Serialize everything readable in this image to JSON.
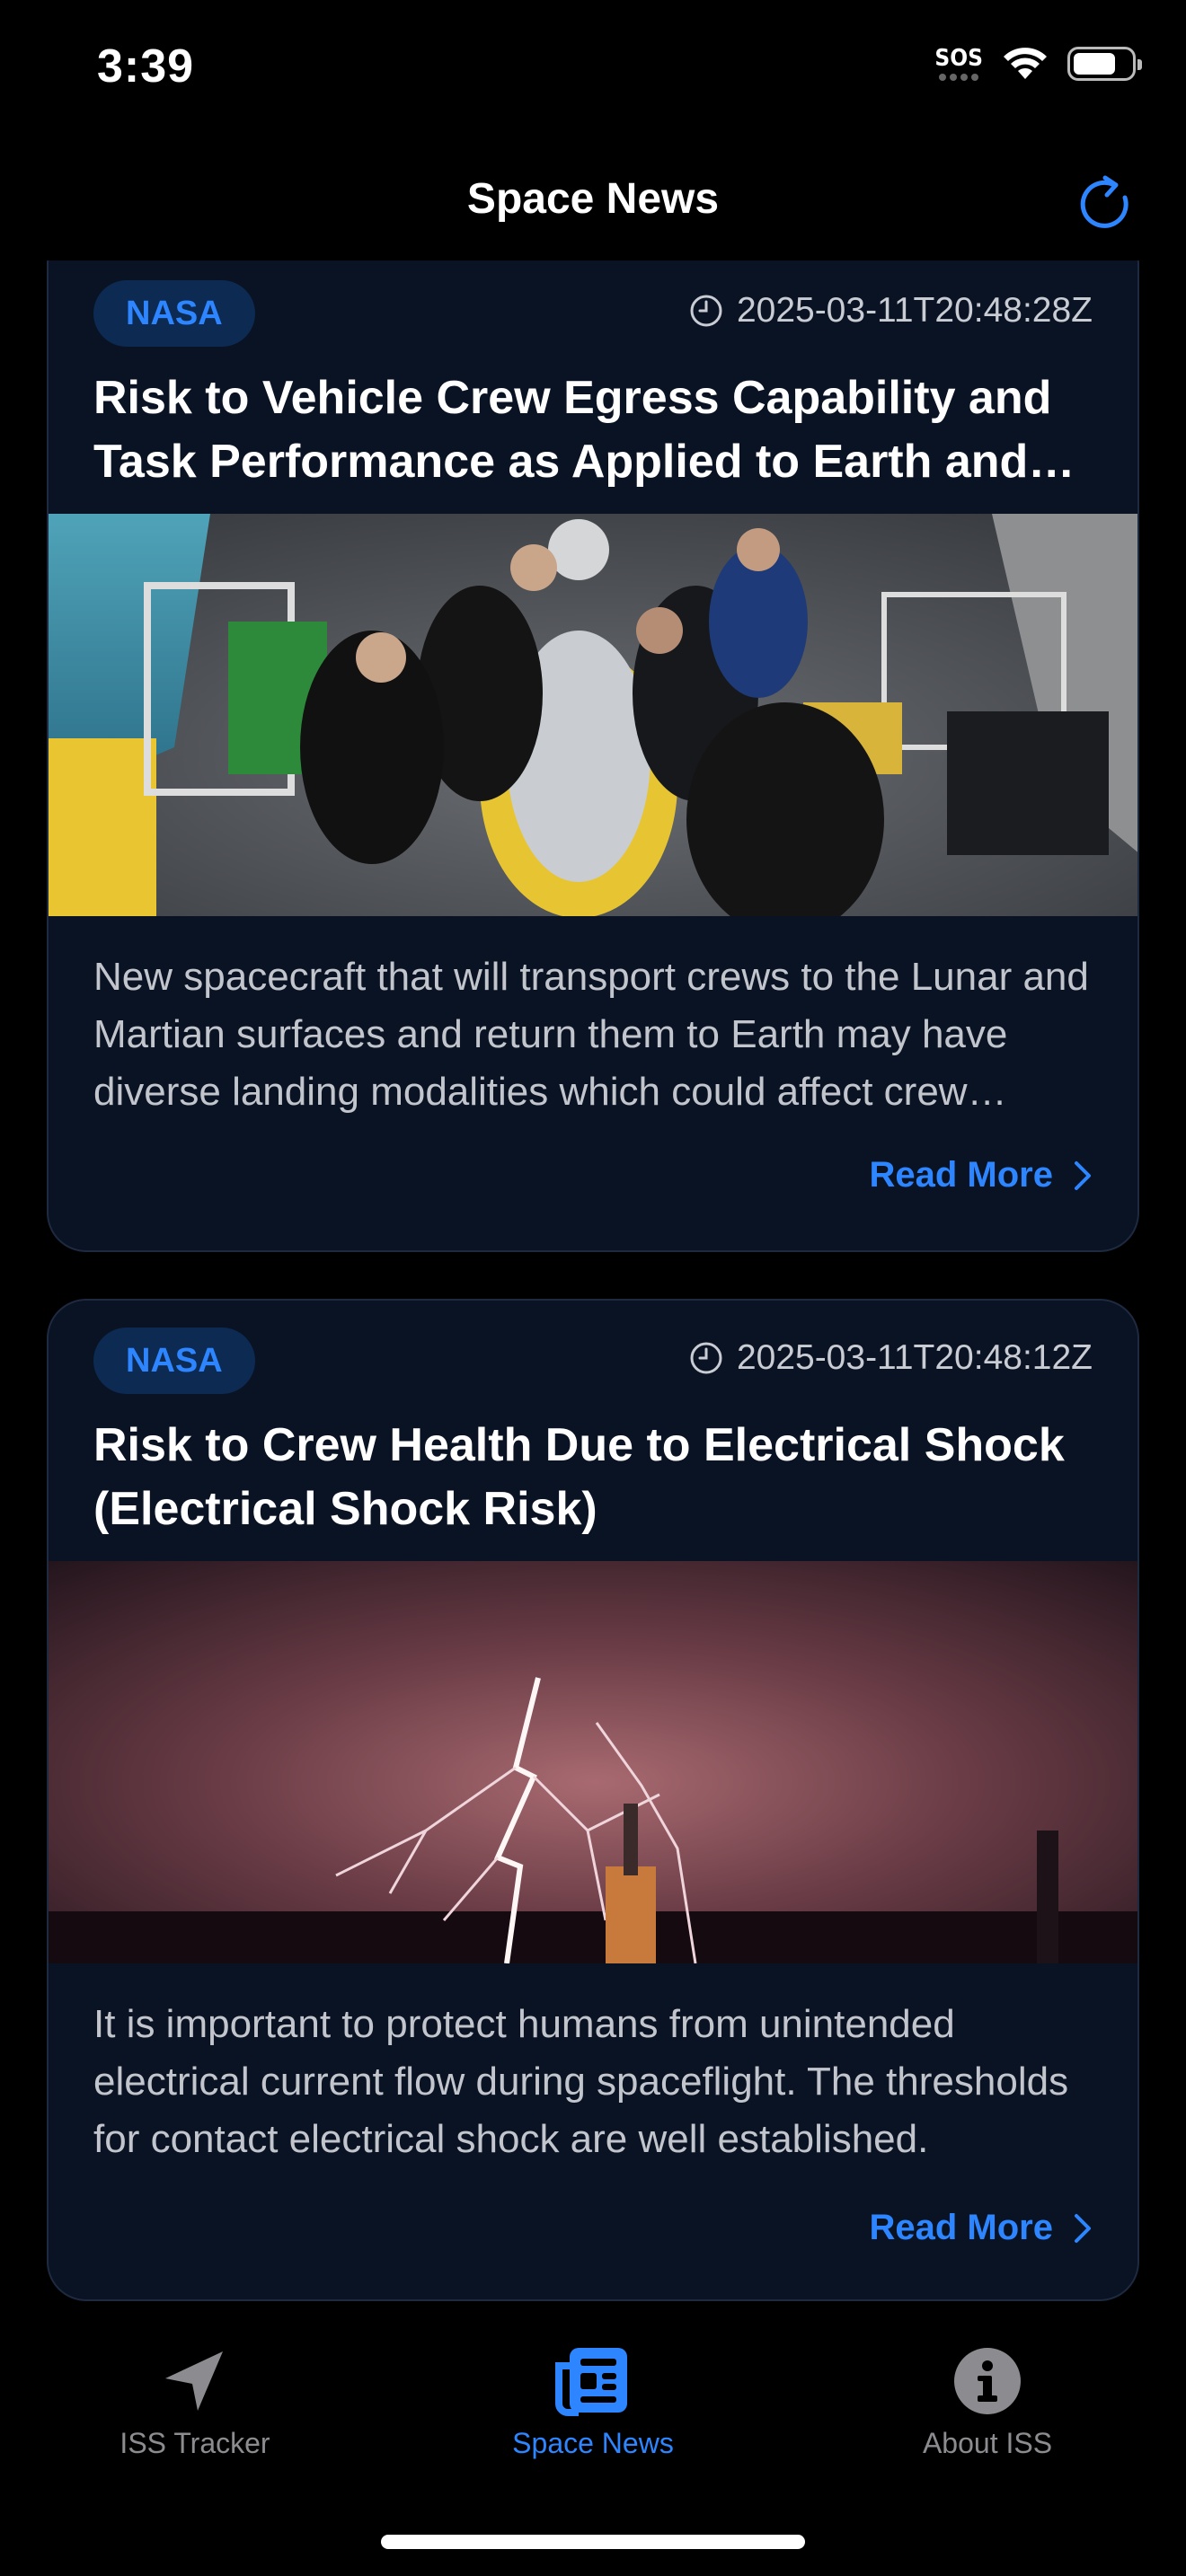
{
  "status": {
    "time": "3:39",
    "sos": "SOS"
  },
  "header": {
    "title": "Space News"
  },
  "articles": [
    {
      "source": "NASA",
      "timestamp": "2025-03-11T20:48:28Z",
      "title": "Risk to Vehicle Crew Egress Capability and Task Performance as Applied to Earth and Other Planetary Surfaces",
      "description": "New spacecraft that will transport crews to the Lunar and Martian surfaces and return them to Earth may have diverse landing modalities which could affect crew egress and task performance.",
      "read_more": "Read More"
    },
    {
      "source": "NASA",
      "timestamp": "2025-03-11T20:48:12Z",
      "title": "Risk to Crew Health Due to Electrical Shock (Electrical Shock Risk)",
      "description": "It is important to protect humans from unintended electrical current flow during spaceflight. The thresholds for contact electrical shock are well established.",
      "read_more": "Read More"
    }
  ],
  "tabs": [
    {
      "label": "ISS Tracker",
      "icon": "location-arrow-icon",
      "active": false
    },
    {
      "label": "Space News",
      "icon": "newspaper-icon",
      "active": true
    },
    {
      "label": "About ISS",
      "icon": "info-icon",
      "active": false
    }
  ],
  "colors": {
    "accent": "#2d86ff",
    "card_bg": "#0a1324",
    "badge_bg": "#0d2a52",
    "inactive": "#8c8c90"
  }
}
